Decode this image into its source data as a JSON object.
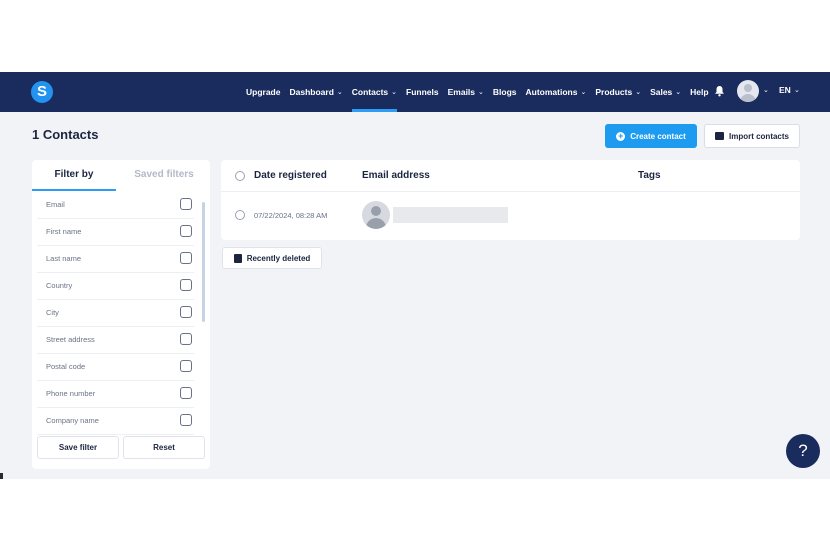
{
  "nav": {
    "logo_letter": "S",
    "items": [
      {
        "label": "Upgrade",
        "chevron": false,
        "active": false
      },
      {
        "label": "Dashboard",
        "chevron": true,
        "active": false
      },
      {
        "label": "Contacts",
        "chevron": true,
        "active": true
      },
      {
        "label": "Funnels",
        "chevron": false,
        "active": false
      },
      {
        "label": "Emails",
        "chevron": true,
        "active": false
      },
      {
        "label": "Blogs",
        "chevron": false,
        "active": false
      },
      {
        "label": "Automations",
        "chevron": true,
        "active": false
      },
      {
        "label": "Products",
        "chevron": true,
        "active": false
      },
      {
        "label": "Sales",
        "chevron": true,
        "active": false
      },
      {
        "label": "Help",
        "chevron": false,
        "active": false
      }
    ],
    "language": "EN",
    "icons": [
      "bell-icon",
      "avatar",
      "chevron-down-icon"
    ]
  },
  "page": {
    "title": "1 Contacts",
    "create_button": "Create contact",
    "import_button": "Import contacts"
  },
  "filter": {
    "tab_filter": "Filter by",
    "tab_saved": "Saved filters",
    "fields": [
      "Email",
      "First name",
      "Last name",
      "Country",
      "City",
      "Street address",
      "Postal code",
      "Phone number",
      "Company name"
    ],
    "save_button": "Save filter",
    "reset_button": "Reset"
  },
  "table": {
    "columns": {
      "date": "Date registered",
      "email": "Email address",
      "tags": "Tags"
    },
    "rows": [
      {
        "date": "07/22/2024, 08:28 AM",
        "email": "",
        "tags": ""
      }
    ]
  },
  "recently_deleted": "Recently deleted",
  "help_button": "?",
  "colors": {
    "nav_bg": "#1a2b5e",
    "accent": "#1d9bf0",
    "page_bg": "#f1f3f7"
  }
}
